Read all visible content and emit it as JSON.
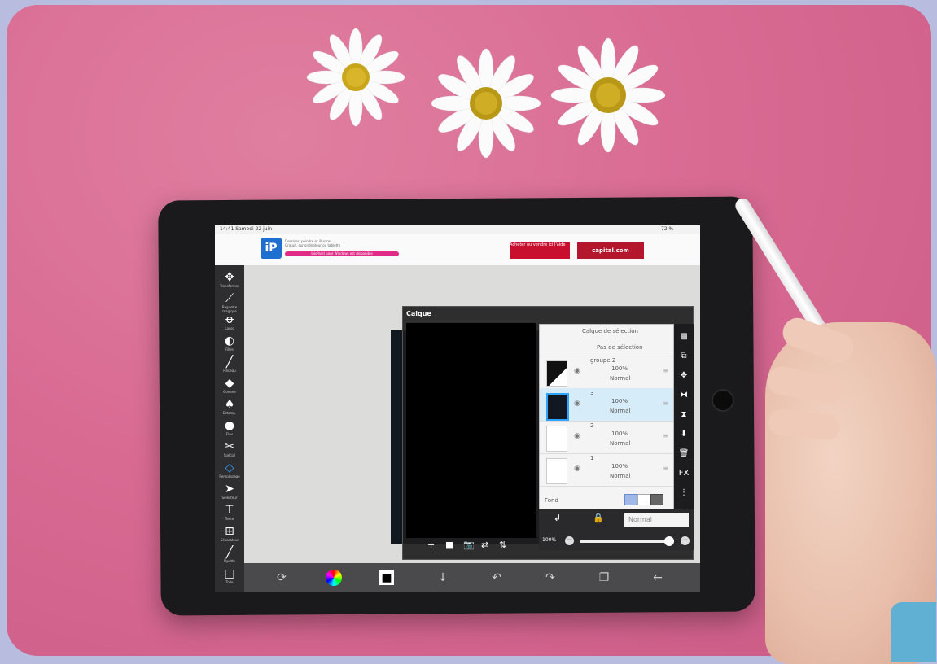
{
  "status_bar": {
    "time_date": "14:41  Samedi 22 juin",
    "battery": "72 %"
  },
  "ad": {
    "logo_text": "iP",
    "line1": "Dessiner, peindre et illustrer",
    "line2": "Gratuit, sur ordinateur ou tablette",
    "pink_button": "ibisPaint pour Windows est disponible",
    "right_text": "Acheter ou vendre ici l'aide",
    "right_brand": "capital.com"
  },
  "toolbar": {
    "items": [
      {
        "icon": "move-icon",
        "glyph": "✥",
        "label": "Transformer"
      },
      {
        "icon": "magic-wand-icon",
        "glyph": "⟋",
        "label": "Baguette magique"
      },
      {
        "icon": "lasso-icon",
        "glyph": "ꝋ",
        "label": "Lasso"
      },
      {
        "icon": "filter-icon",
        "glyph": "◐",
        "label": "Filtre"
      },
      {
        "icon": "brush-icon",
        "glyph": "╱",
        "label": "Pinceau"
      },
      {
        "icon": "eraser-icon",
        "glyph": "◆",
        "label": "Gomme"
      },
      {
        "icon": "smudge-icon",
        "glyph": "♠",
        "label": "Estomp."
      },
      {
        "icon": "fill-icon",
        "glyph": "●",
        "label": "Flou"
      },
      {
        "icon": "magic-icon",
        "glyph": "✂",
        "label": "Spécial"
      },
      {
        "icon": "bucket-icon",
        "glyph": "◇",
        "label": "Remplissage"
      },
      {
        "icon": "select-arrow-icon",
        "glyph": "➤",
        "label": "Sélecteur"
      },
      {
        "icon": "text-icon",
        "glyph": "T",
        "label": "Texte"
      },
      {
        "icon": "frame-icon",
        "glyph": "⊞",
        "label": "Séparateur"
      },
      {
        "icon": "pipette-icon",
        "glyph": "╱",
        "label": "Pipette"
      },
      {
        "icon": "canvas-icon",
        "glyph": "□",
        "label": "Toile"
      }
    ]
  },
  "calque": {
    "title": "Calque",
    "tools": [
      "+",
      "■",
      "📷",
      "⇄",
      "⇅"
    ]
  },
  "layers": {
    "selection_layer": "Calque de sélection",
    "selection_state": "Pas de sélection",
    "rows": [
      {
        "name": "groupe 2",
        "opacity": "100%",
        "mode": "Normal"
      },
      {
        "name": "3",
        "opacity": "100%",
        "mode": "Normal"
      },
      {
        "name": "2",
        "opacity": "100%",
        "mode": "Normal"
      },
      {
        "name": "1",
        "opacity": "100%",
        "mode": "Normal"
      }
    ],
    "fond_label": "Fond"
  },
  "side_buttons": [
    "▩",
    "⧉",
    "✥",
    "⧓",
    "⧗",
    "⬇",
    "🗑",
    "FX",
    "⋮"
  ],
  "blend": {
    "mode": "Normal"
  },
  "opacity": {
    "label": "100%",
    "value_percent": 100
  },
  "bottom_bar": [
    "⟳",
    "◉",
    "■",
    "↓",
    "↶",
    "↷",
    "❐",
    "←"
  ]
}
